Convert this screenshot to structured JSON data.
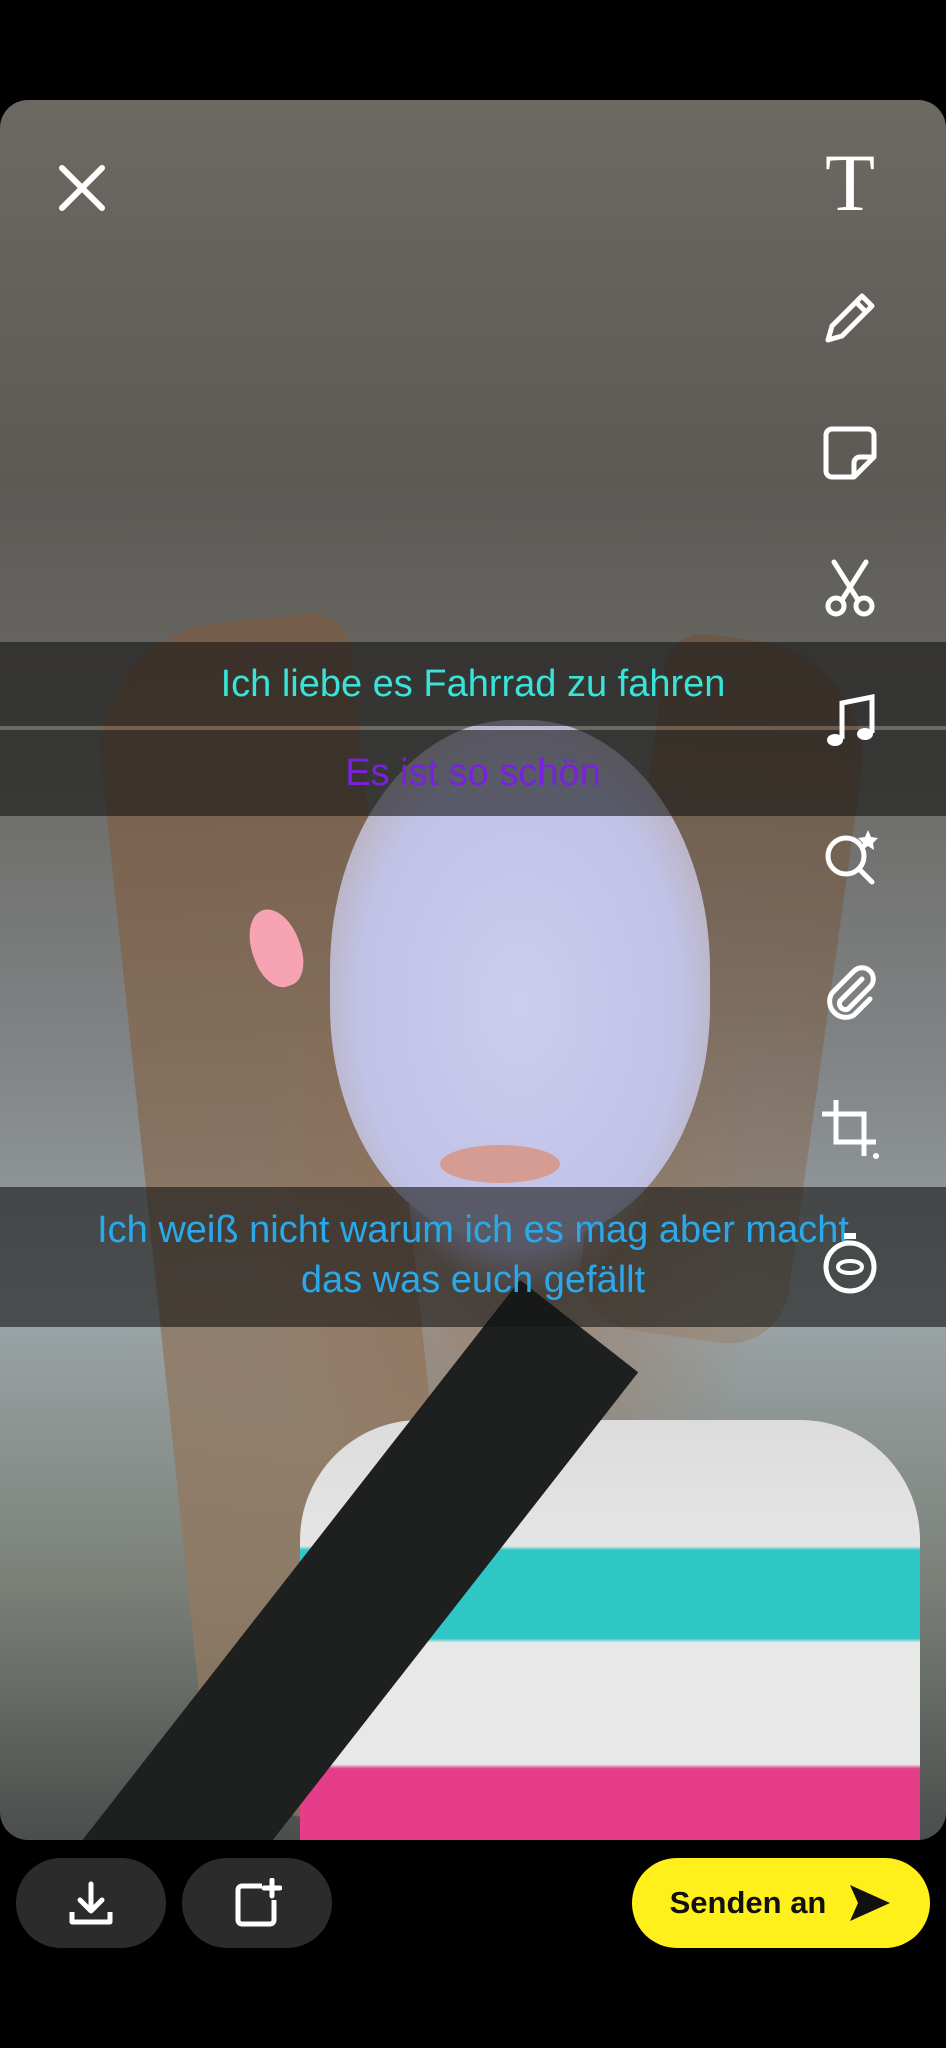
{
  "captions": [
    {
      "lines": [
        "Ich liebe es Fahrrad zu fahren"
      ],
      "color": "#39e3d8"
    },
    {
      "lines": [
        "Es ist so schön"
      ],
      "color": "#7a20e0"
    },
    {
      "lines": [
        "Ich weiß nicht warum ich es mag aber macht",
        "das was euch gefällt"
      ],
      "color": "#2aa9ea"
    }
  ],
  "toolbar": {
    "text_glyph": "T",
    "icons": [
      "text-icon",
      "pencil-icon",
      "sticker-icon",
      "scissors-icon",
      "music-icon",
      "lens-search-icon",
      "paperclip-icon",
      "crop-icon",
      "timer-icon"
    ]
  },
  "bottom": {
    "download_icon": "download-icon",
    "story_icon": "add-story-icon",
    "send_label": "Senden an",
    "send_icon": "send-arrow-icon"
  },
  "colors": {
    "send_button": "#fff01c",
    "pill_button": "#2b2b2b"
  }
}
